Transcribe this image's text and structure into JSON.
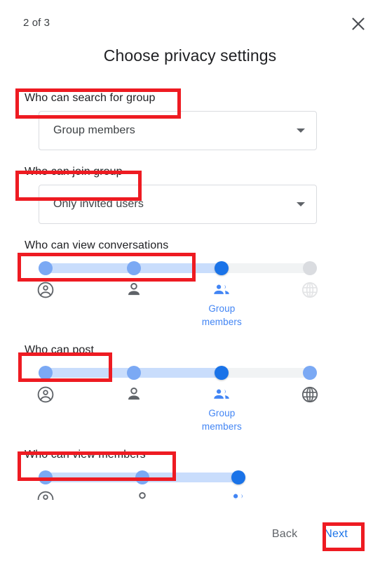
{
  "header": {
    "step_counter": "2 of 3",
    "close_icon": "close-icon",
    "title": "Choose privacy settings"
  },
  "fields": [
    {
      "id": "who-can-search-for-group",
      "label": "Who can search for group",
      "type": "select",
      "value": "Group members",
      "arrow_icon": "chevron-down-icon"
    },
    {
      "id": "who-can-join-group",
      "label": "Who can join group",
      "type": "select",
      "value": "Only invited users",
      "arrow_icon": "chevron-down-icon"
    },
    {
      "id": "who-can-view-conversations",
      "label": "Who can view conversations",
      "type": "slider",
      "selected_index": 2,
      "selected_caption": "Group members",
      "options": [
        {
          "icon": "account-circle-icon",
          "state": "passed"
        },
        {
          "icon": "person-icon",
          "state": "passed"
        },
        {
          "icon": "people-group-icon",
          "state": "current"
        },
        {
          "icon": "globe-icon",
          "state": "inactive"
        }
      ]
    },
    {
      "id": "who-can-post",
      "label": "Who can post",
      "type": "slider",
      "selected_index": 2,
      "selected_caption": "Group members",
      "options": [
        {
          "icon": "account-circle-icon",
          "state": "passed"
        },
        {
          "icon": "person-icon",
          "state": "passed"
        },
        {
          "icon": "people-group-icon",
          "state": "current"
        },
        {
          "icon": "globe-icon",
          "state": "enabled"
        }
      ]
    },
    {
      "id": "who-can-view-members",
      "label": "Who can view members",
      "type": "slider",
      "selected_index": 2,
      "selected_caption": "",
      "options": [
        {
          "icon": "account-circle-icon",
          "state": "passed"
        },
        {
          "icon": "person-icon",
          "state": "passed"
        },
        {
          "icon": "people-group-icon",
          "state": "current"
        }
      ]
    }
  ],
  "footer": {
    "back_label": "Back",
    "next_label": "Next"
  },
  "colors": {
    "accent_blue": "#1a73e8",
    "caption_blue": "#4285f4",
    "thumb_passed": "#7ba9f4",
    "thumb_inactive": "#dadce0",
    "track_fill": "#c9ddfc",
    "track_base": "#f1f3f4",
    "annotation_red": "#ee1b22",
    "text_primary": "#202124",
    "text_secondary": "#5f6368"
  }
}
